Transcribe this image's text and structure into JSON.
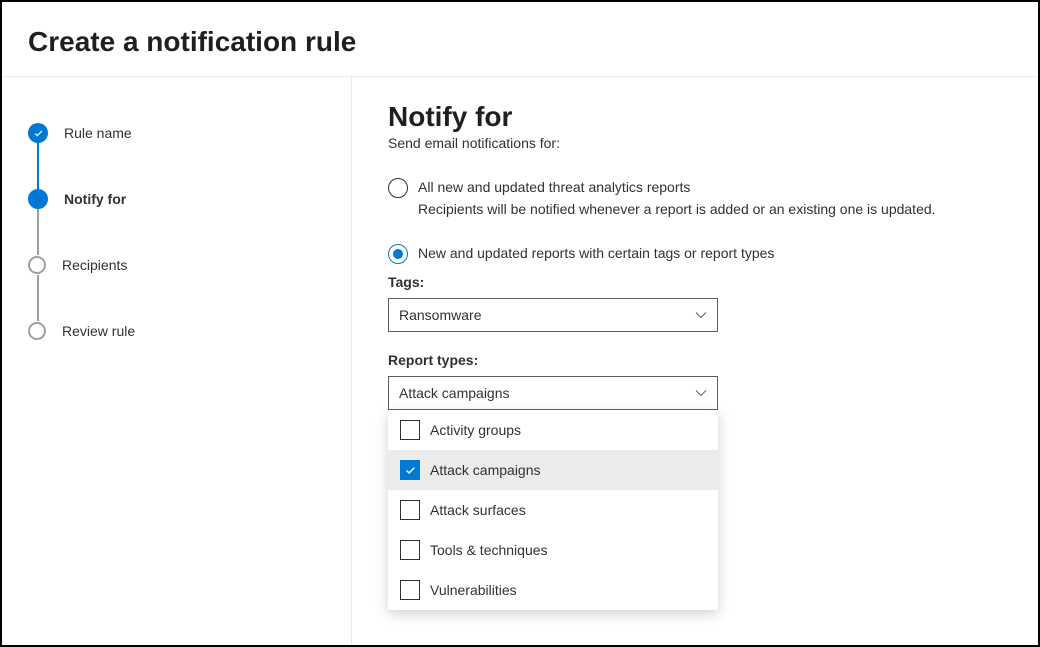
{
  "header": {
    "title": "Create a notification rule"
  },
  "steps": [
    {
      "label": "Rule name",
      "state": "completed"
    },
    {
      "label": "Notify for",
      "state": "current"
    },
    {
      "label": "Recipients",
      "state": "pending"
    },
    {
      "label": "Review rule",
      "state": "pending"
    }
  ],
  "main": {
    "heading": "Notify for",
    "subtitle": "Send email notifications for:",
    "radios": [
      {
        "label": "All new and updated threat analytics reports",
        "description": "Recipients will be notified whenever a report is added or an existing one is updated.",
        "selected": false
      },
      {
        "label": "New and updated reports with certain tags or report types",
        "selected": true
      }
    ],
    "tags": {
      "label": "Tags:",
      "value": "Ransomware"
    },
    "reportTypes": {
      "label": "Report types:",
      "value": "Attack campaigns",
      "options": [
        {
          "label": "Activity groups",
          "checked": false
        },
        {
          "label": "Attack campaigns",
          "checked": true
        },
        {
          "label": "Attack surfaces",
          "checked": false
        },
        {
          "label": "Tools & techniques",
          "checked": false
        },
        {
          "label": "Vulnerabilities",
          "checked": false
        }
      ]
    }
  }
}
